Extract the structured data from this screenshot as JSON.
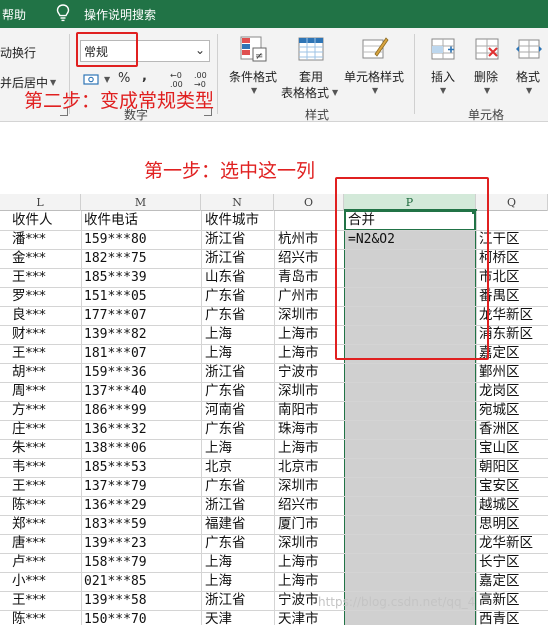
{
  "topbar": {
    "help_label": "帮助",
    "bulb_icon": "lightbulb-icon",
    "tell_me": "操作说明搜索"
  },
  "ribbon": {
    "wrap_text": "动换行",
    "merge_center": "并后居中",
    "number_format": {
      "value": "常规",
      "chevron_icon": "chevron-down-icon"
    },
    "percent_symbol": "%",
    "comma_symbol": ",",
    "group_number_label": "数字",
    "conditional_format": "条件格式",
    "format_table_line1": "套用",
    "format_table_line2": "表格格式",
    "cell_styles": "单元格样式",
    "group_styles_label": "样式",
    "insert": "插入",
    "delete": "删除",
    "format": "格式",
    "group_cells_label": "单元格"
  },
  "annotations": {
    "step2": "第二步：变成常规类型",
    "step1": "第一步：选中这一列",
    "color": "#e02020"
  },
  "columns": [
    "L",
    "M",
    "N",
    "O",
    "P",
    "Q"
  ],
  "selected_column": "P",
  "header_row": {
    "L": "收件人",
    "M": "收件电话",
    "N": "收件城市",
    "O": "",
    "P": "合并",
    "Q": ""
  },
  "rows": [
    {
      "L": "潘***",
      "M": "159***80",
      "N": "浙江省",
      "O": "杭州市",
      "P": "=N2&O2",
      "Q": "江干区"
    },
    {
      "L": "金***",
      "M": "182***75",
      "N": "浙江省",
      "O": "绍兴市",
      "P": "",
      "Q": "柯桥区"
    },
    {
      "L": "王***",
      "M": "185***39",
      "N": "山东省",
      "O": "青岛市",
      "P": "",
      "Q": "市北区"
    },
    {
      "L": "罗***",
      "M": "151***05",
      "N": "广东省",
      "O": "广州市",
      "P": "",
      "Q": "番禺区"
    },
    {
      "L": "良***",
      "M": "177***07",
      "N": "广东省",
      "O": "深圳市",
      "P": "",
      "Q": "龙华新区"
    },
    {
      "L": "财***",
      "M": "139***82",
      "N": "上海",
      "O": "上海市",
      "P": "",
      "Q": "浦东新区"
    },
    {
      "L": "王***",
      "M": "181***07",
      "N": "上海",
      "O": "上海市",
      "P": "",
      "Q": "嘉定区"
    },
    {
      "L": "胡***",
      "M": "159***36",
      "N": "浙江省",
      "O": "宁波市",
      "P": "",
      "Q": "鄞州区"
    },
    {
      "L": "周***",
      "M": "137***40",
      "N": "广东省",
      "O": "深圳市",
      "P": "",
      "Q": "龙岗区"
    },
    {
      "L": "方***",
      "M": "186***99",
      "N": "河南省",
      "O": "南阳市",
      "P": "",
      "Q": "宛城区"
    },
    {
      "L": "庄***",
      "M": "136***32",
      "N": "广东省",
      "O": "珠海市",
      "P": "",
      "Q": "香洲区"
    },
    {
      "L": "朱***",
      "M": "138***06",
      "N": "上海",
      "O": "上海市",
      "P": "",
      "Q": "宝山区"
    },
    {
      "L": "韦***",
      "M": "185***53",
      "N": "北京",
      "O": "北京市",
      "P": "",
      "Q": "朝阳区"
    },
    {
      "L": "王***",
      "M": "137***79",
      "N": "广东省",
      "O": "深圳市",
      "P": "",
      "Q": "宝安区"
    },
    {
      "L": "陈***",
      "M": "136***29",
      "N": "浙江省",
      "O": "绍兴市",
      "P": "",
      "Q": "越城区"
    },
    {
      "L": "郑***",
      "M": "183***59",
      "N": "福建省",
      "O": "厦门市",
      "P": "",
      "Q": "思明区"
    },
    {
      "L": "唐***",
      "M": "139***23",
      "N": "广东省",
      "O": "深圳市",
      "P": "",
      "Q": "龙华新区"
    },
    {
      "L": "卢***",
      "M": "158***79",
      "N": "上海",
      "O": "上海市",
      "P": "",
      "Q": "长宁区"
    },
    {
      "L": "小***",
      "M": "021***85",
      "N": "上海",
      "O": "上海市",
      "P": "",
      "Q": "嘉定区"
    },
    {
      "L": "王***",
      "M": "139***58",
      "N": "浙江省",
      "O": "宁波市",
      "P": "",
      "Q": "高新区"
    },
    {
      "L": "陈***",
      "M": "150***70",
      "N": "天津",
      "O": "天津市",
      "P": "",
      "Q": "西青区"
    }
  ],
  "watermark": "https://blog.csdn.net/qq_4"
}
